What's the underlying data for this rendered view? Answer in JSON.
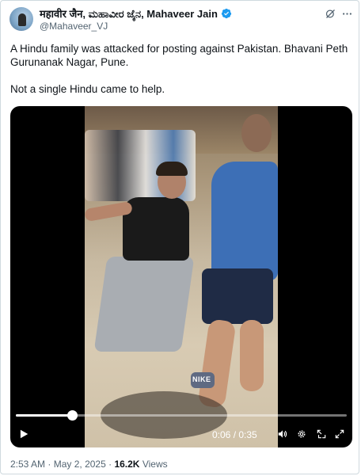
{
  "author": {
    "display_name": "महावीर जैन, ಮಹಾವೀರ ಜೈನ, Mahaveer Jain",
    "handle": "@Mahaveer_VJ",
    "verified": true,
    "verified_color": "#1d9bf0"
  },
  "tweet": {
    "paragraphs": [
      "A Hindu family was attacked for posting against Pakistan. Bhavani Peth Gurunanak Nagar, Pune.",
      "Not a single Hindu came to help."
    ]
  },
  "video": {
    "overlay_text": "NIKE",
    "progress": 0.171,
    "current_time": "0:06",
    "duration": "0:35",
    "time_display": "0:06 / 0:35",
    "controls": [
      "play-icon",
      "volume-icon",
      "settings-icon",
      "picture-in-picture-icon",
      "fullscreen-icon"
    ]
  },
  "meta": {
    "time": "2:53 AM",
    "separator": "·",
    "date": "May 2, 2025",
    "views_count": "16.2K",
    "views_label": "Views"
  },
  "colors": {
    "text_primary": "#0f1419",
    "text_secondary": "#536471",
    "border": "#cfd9de"
  }
}
